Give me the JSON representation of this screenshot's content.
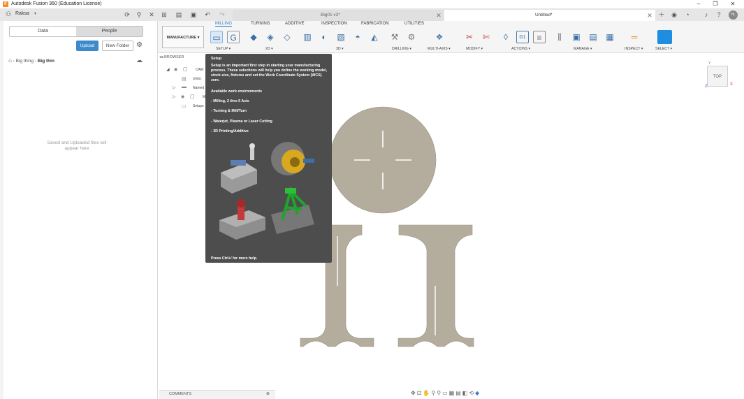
{
  "window": {
    "title": "Autodesk Fusion 360 (Education License)"
  },
  "toolbar": {
    "team": "Raksa"
  },
  "tabs": [
    {
      "label": "Big01 v3*"
    },
    {
      "label": "Untitled*"
    }
  ],
  "data_panel": {
    "tab_data": "Data",
    "tab_people": "People",
    "upload": "Upload",
    "new_folder": "New Folder",
    "breadcrumb": [
      "Big thing",
      "Big thin"
    ],
    "empty": "Saved and Uploaded files will appear here"
  },
  "ribbon": {
    "workspace": "MANUFACTURE ▾",
    "tabs": [
      "MILLING",
      "TURNING",
      "ADDITIVE",
      "INSPECTION",
      "FABRICATION",
      "UTILITIES"
    ],
    "groups": [
      "SETUP ▾",
      "2D ▾",
      "3D ▾",
      "DRILLING ▾",
      "MULTI-AXIS ▾",
      "MODIFY ▾",
      "ACTIONS ▾",
      "MANAGE ▾",
      "INSPECT ▾",
      "SELECT ▾"
    ]
  },
  "browser": {
    "header": "BROWSER",
    "items": [
      "CAM",
      "Units:",
      "Named",
      "M",
      "Setups"
    ]
  },
  "tooltip": {
    "title": "Setup",
    "description": "Setup is an important first step in starting your manufacturing process. These selections will help you define the working model, stock size, fixtures and set the Work Coordinate System (WCS) zero.",
    "env_header": "Available work environments",
    "envs": [
      "- Milling, 2 thru 5 Axis",
      "- Turning & Mill/Turn",
      "- Waterjet, Plasma or Laser Cutting",
      "- 3D Printing/Additive"
    ],
    "footer": "Press Ctrl+/ for more help."
  },
  "viewcube": {
    "face": "TOP"
  },
  "comments": {
    "label": "COMMENTS"
  },
  "colors": {
    "part": "#b4ac9c",
    "accent": "#1f8de0",
    "tooltip_bg": "#4d4d4d"
  }
}
